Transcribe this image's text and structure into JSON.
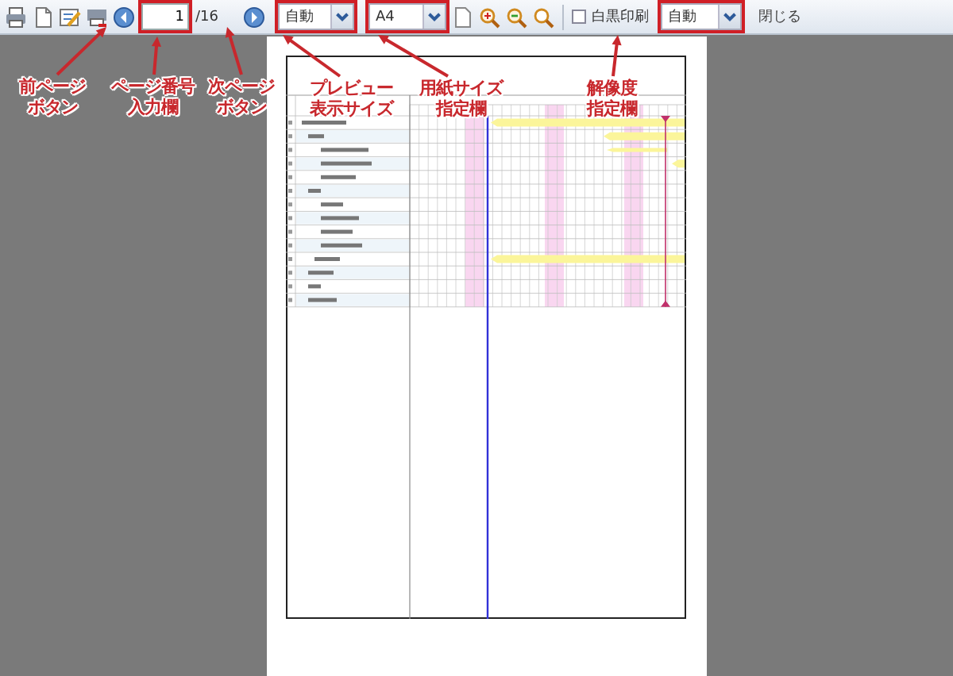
{
  "toolbar": {
    "page_input": {
      "value": "1",
      "total": "/16"
    },
    "zoom_select": {
      "value": "自動"
    },
    "paper_select": {
      "value": "A4"
    },
    "mono_print": {
      "label": "白黒印刷",
      "checked": false
    },
    "resolution_select": {
      "value": "自動"
    },
    "close_button": {
      "label": "閉じる"
    }
  },
  "callouts": [
    {
      "lines": [
        "前ページ",
        "ボタン"
      ]
    },
    {
      "lines": [
        "ページ番号",
        "入力欄"
      ]
    },
    {
      "lines": [
        "次ページ",
        "ボタン"
      ]
    },
    {
      "lines": [
        "プレビュー",
        "表示サイズ"
      ]
    },
    {
      "lines": [
        "用紙サイズ",
        "指定欄"
      ]
    },
    {
      "lines": [
        "解像度",
        "指定欄"
      ]
    }
  ]
}
